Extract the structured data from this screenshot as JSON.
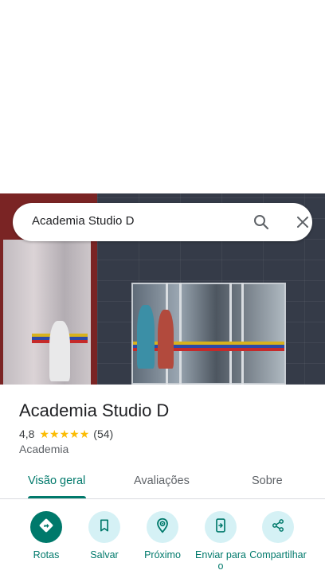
{
  "search": {
    "query": "Academia Studio D"
  },
  "place": {
    "name": "Academia Studio D",
    "rating": "4,8",
    "stars": 5,
    "review_count": "(54)",
    "category": "Academia"
  },
  "tabs": [
    {
      "label": "Visão geral",
      "active": true
    },
    {
      "label": "Avaliações",
      "active": false
    },
    {
      "label": "Sobre",
      "active": false
    }
  ],
  "actions": [
    {
      "label": "Rotas",
      "icon": "directions-icon"
    },
    {
      "label": "Salvar",
      "icon": "bookmark-icon"
    },
    {
      "label": "Próximo",
      "icon": "nearby-icon"
    },
    {
      "label": "Enviar para o",
      "icon": "send-to-phone-icon"
    },
    {
      "label": "Compartilhar",
      "icon": "share-icon"
    }
  ],
  "colors": {
    "accent": "#00796b",
    "action_bg": "#d5f1f5",
    "star": "#fbbc04"
  }
}
